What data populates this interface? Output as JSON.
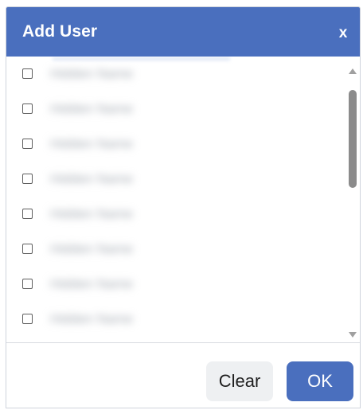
{
  "dialog": {
    "title": "Add User",
    "close_label": "x"
  },
  "user_list": {
    "items": [
      {
        "checked": false,
        "label": "Hidden Name"
      },
      {
        "checked": false,
        "label": "Hidden Name"
      },
      {
        "checked": false,
        "label": "Hidden Name"
      },
      {
        "checked": false,
        "label": "Hidden Name"
      },
      {
        "checked": false,
        "label": "Hidden Name"
      },
      {
        "checked": false,
        "label": "Hidden Name"
      },
      {
        "checked": false,
        "label": "Hidden Name"
      },
      {
        "checked": false,
        "label": "Hidden Name"
      }
    ]
  },
  "buttons": {
    "clear_label": "Clear",
    "ok_label": "OK"
  },
  "colors": {
    "accent": "#4A6FBE",
    "header_text": "#FFFFFF",
    "secondary_button": "#EEF0F2"
  },
  "icons": {
    "close": "close-icon",
    "checkbox": "checkbox-icon",
    "scroll_up": "scroll-up-icon",
    "scroll_down": "scroll-down-icon"
  }
}
